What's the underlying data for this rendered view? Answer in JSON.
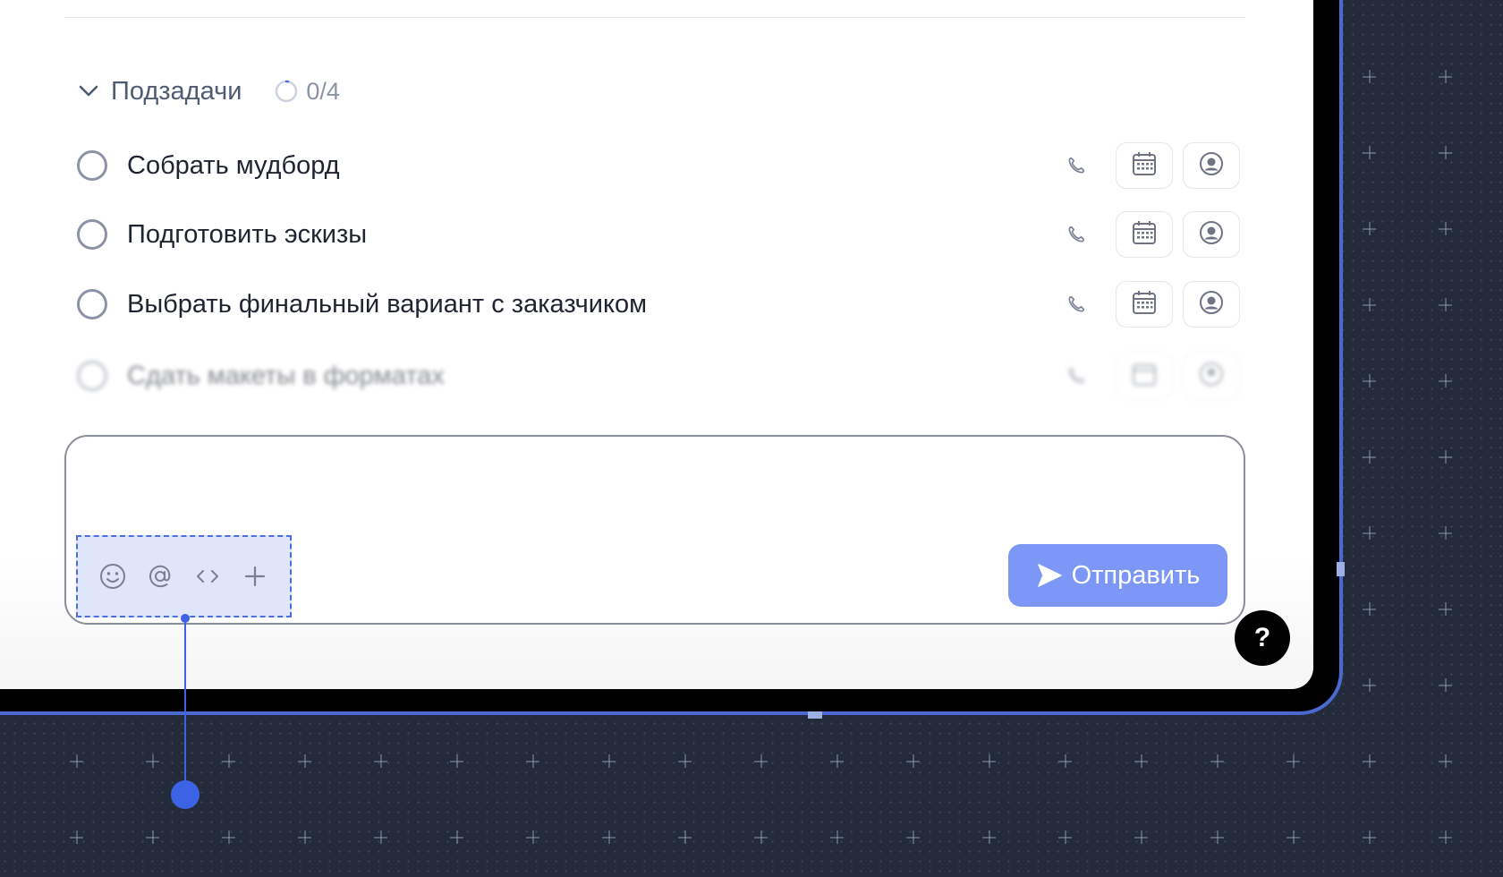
{
  "subtasks": {
    "title": "Подзадачи",
    "progress": "0/4",
    "items": [
      {
        "label": "Собрать мудборд"
      },
      {
        "label": "Подготовить эскизы"
      },
      {
        "label": "Выбрать финальный вариант с заказчиком"
      },
      {
        "label": "Сдать макеты в форматах"
      }
    ]
  },
  "composer": {
    "toolbar_icons": [
      "smiley-icon",
      "at-sign-icon",
      "code-icon",
      "plus-icon"
    ],
    "send_label": "Отправить"
  },
  "help": {
    "label": "?"
  },
  "colors": {
    "accent": "#7c97f5",
    "callout": "#3c62e5",
    "background": "#232b3a"
  }
}
